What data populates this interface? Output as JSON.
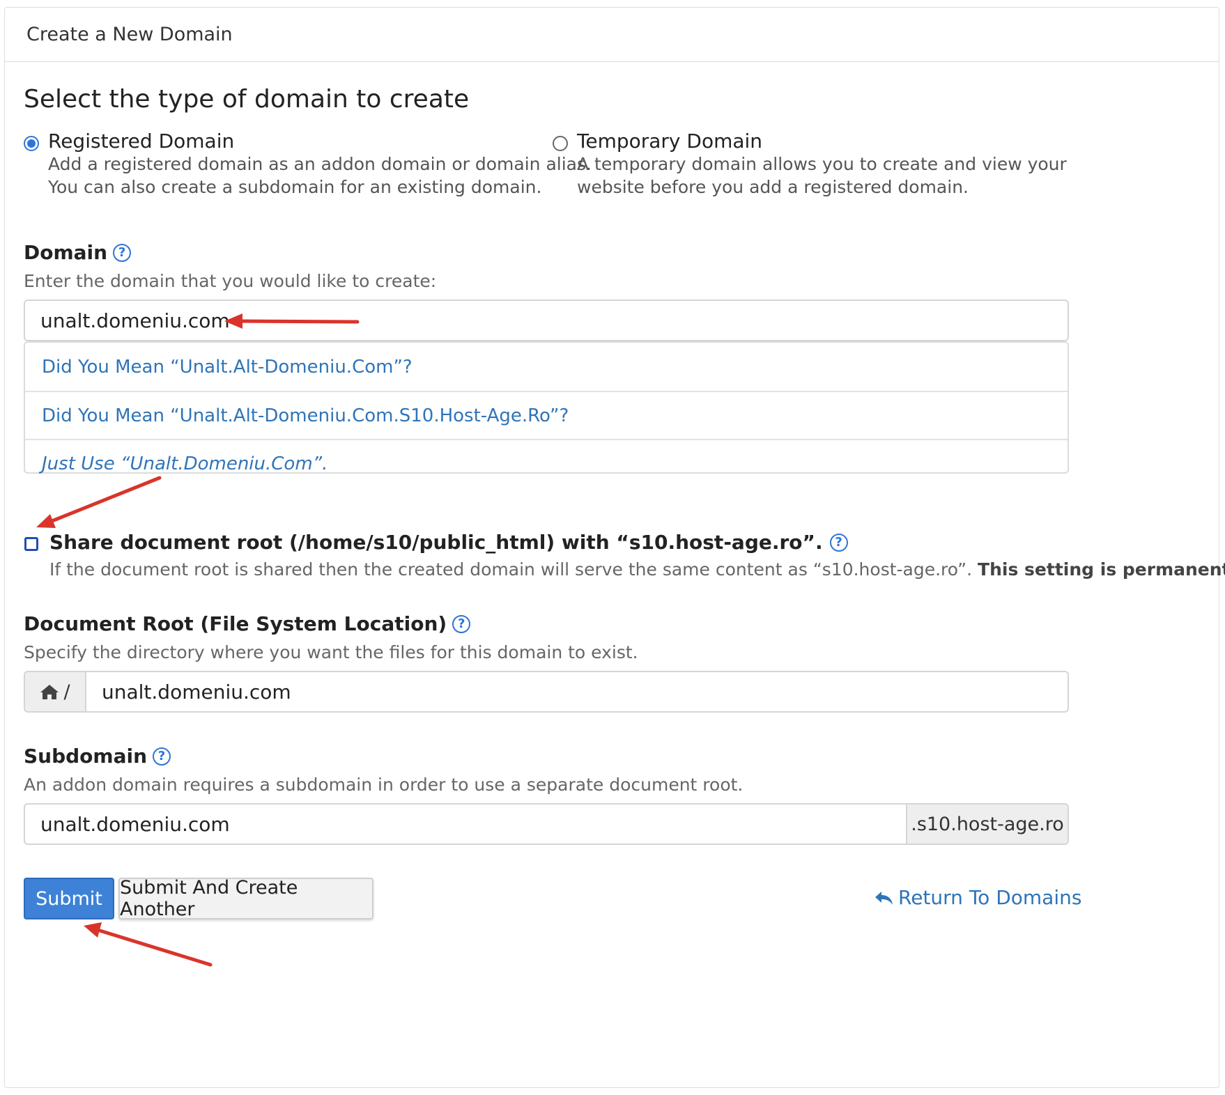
{
  "panel": {
    "title": "Create a New Domain"
  },
  "section_title": "Select the type of domain to create",
  "domain_types": {
    "registered": {
      "label": "Registered Domain",
      "desc1": "Add a registered domain as an addon domain or domain alias.",
      "desc2": "You can also create a subdomain for an existing domain.",
      "checked": true
    },
    "temporary": {
      "label": "Temporary Domain",
      "desc1": "A temporary domain allows you to create and view your",
      "desc2": "website before you add a registered domain.",
      "checked": false
    }
  },
  "domain": {
    "label": "Domain",
    "hint": "Enter the domain that you would like to create:",
    "value": "unalt.domeniu.com",
    "suggestions": [
      "Did You Mean “Unalt.Alt-Domeniu.Com”?",
      "Did You Mean “Unalt.Alt-Domeniu.Com.S10.Host-Age.Ro”?",
      "Just Use “Unalt.Domeniu.Com”."
    ]
  },
  "share_root": {
    "label": "Share document root (/home/s10/public_html) with “s10.host-age.ro”.",
    "desc": "If the document root is shared then the created domain will serve the same content as “s10.host-age.ro”.",
    "desc_bold": "This setting is permanent.",
    "checked": false
  },
  "document_root": {
    "label": "Document Root (File System Location)",
    "hint": "Specify the directory where you want the files for this domain to exist.",
    "prefix": "/",
    "value": "unalt.domeniu.com"
  },
  "subdomain": {
    "label": "Subdomain",
    "hint": "An addon domain requires a subdomain in order to use a separate document root.",
    "value": "unalt.domeniu.com",
    "suffix": ".s10.host-age.ro"
  },
  "actions": {
    "submit": "Submit",
    "submit_another": "Submit And Create Another",
    "return": "Return To Domains"
  },
  "colors": {
    "accent": "#2f74d8",
    "link": "#2f74b8",
    "annotation_arrow": "#d9342b"
  }
}
